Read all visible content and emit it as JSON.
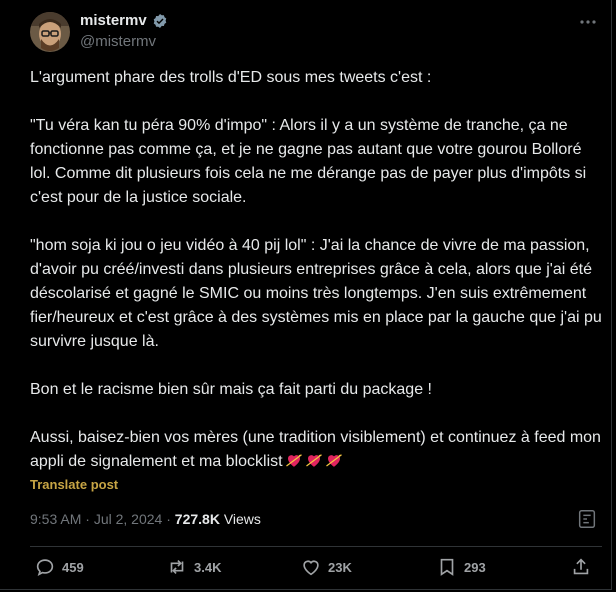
{
  "author": {
    "display_name": "mistermv",
    "handle": "@mistermv",
    "verified": true
  },
  "post": {
    "paragraphs": [
      "L'argument phare des trolls d'ED sous mes tweets c'est :",
      "\"Tu véra kan tu péra 90% d'impo\" : Alors il y a un système de tranche, ça ne fonctionne pas comme ça, et je ne gagne pas autant que votre gourou Bolloré lol. Comme dit plusieurs fois cela ne me dérange pas de payer plus d'impôts si c'est pour de la justice sociale.",
      "\"hom soja ki jou o jeu vidéo à 40 pij lol\" : J'ai la chance de vivre de ma passion, d'avoir pu créé/investi dans plusieurs entreprises grâce à cela, alors que j'ai été déscolarisé et gagné le SMIC ou moins très longtemps. J'en suis extrêmement fier/heureux et c'est grâce à des systèmes mis en place par la gauche que j'ai pu survivre jusque là.",
      "Bon et le racisme bien sûr mais ça fait parti du package !",
      "Aussi, baisez-bien vos mères (une tradition visiblement) et continuez à feed mon appli de signalement et ma blocklist"
    ],
    "trailing_emoji": [
      "heart-with-arrow",
      "heart-with-arrow",
      "heart-with-arrow"
    ],
    "translate_label": "Translate post"
  },
  "meta": {
    "time": "9:53 AM",
    "separator": " · ",
    "date": "Jul 2, 2024",
    "views_count": "727.8K",
    "views_label": "Views"
  },
  "actions": {
    "replies": "459",
    "reposts": "3.4K",
    "likes": "23K",
    "bookmarks": "293"
  },
  "colors": {
    "background": "#000000",
    "text": "#e7e9ea",
    "muted": "#71767b",
    "verified": "#829aab",
    "translate": "#c7a545",
    "emoji_heart": "#e0245e"
  }
}
